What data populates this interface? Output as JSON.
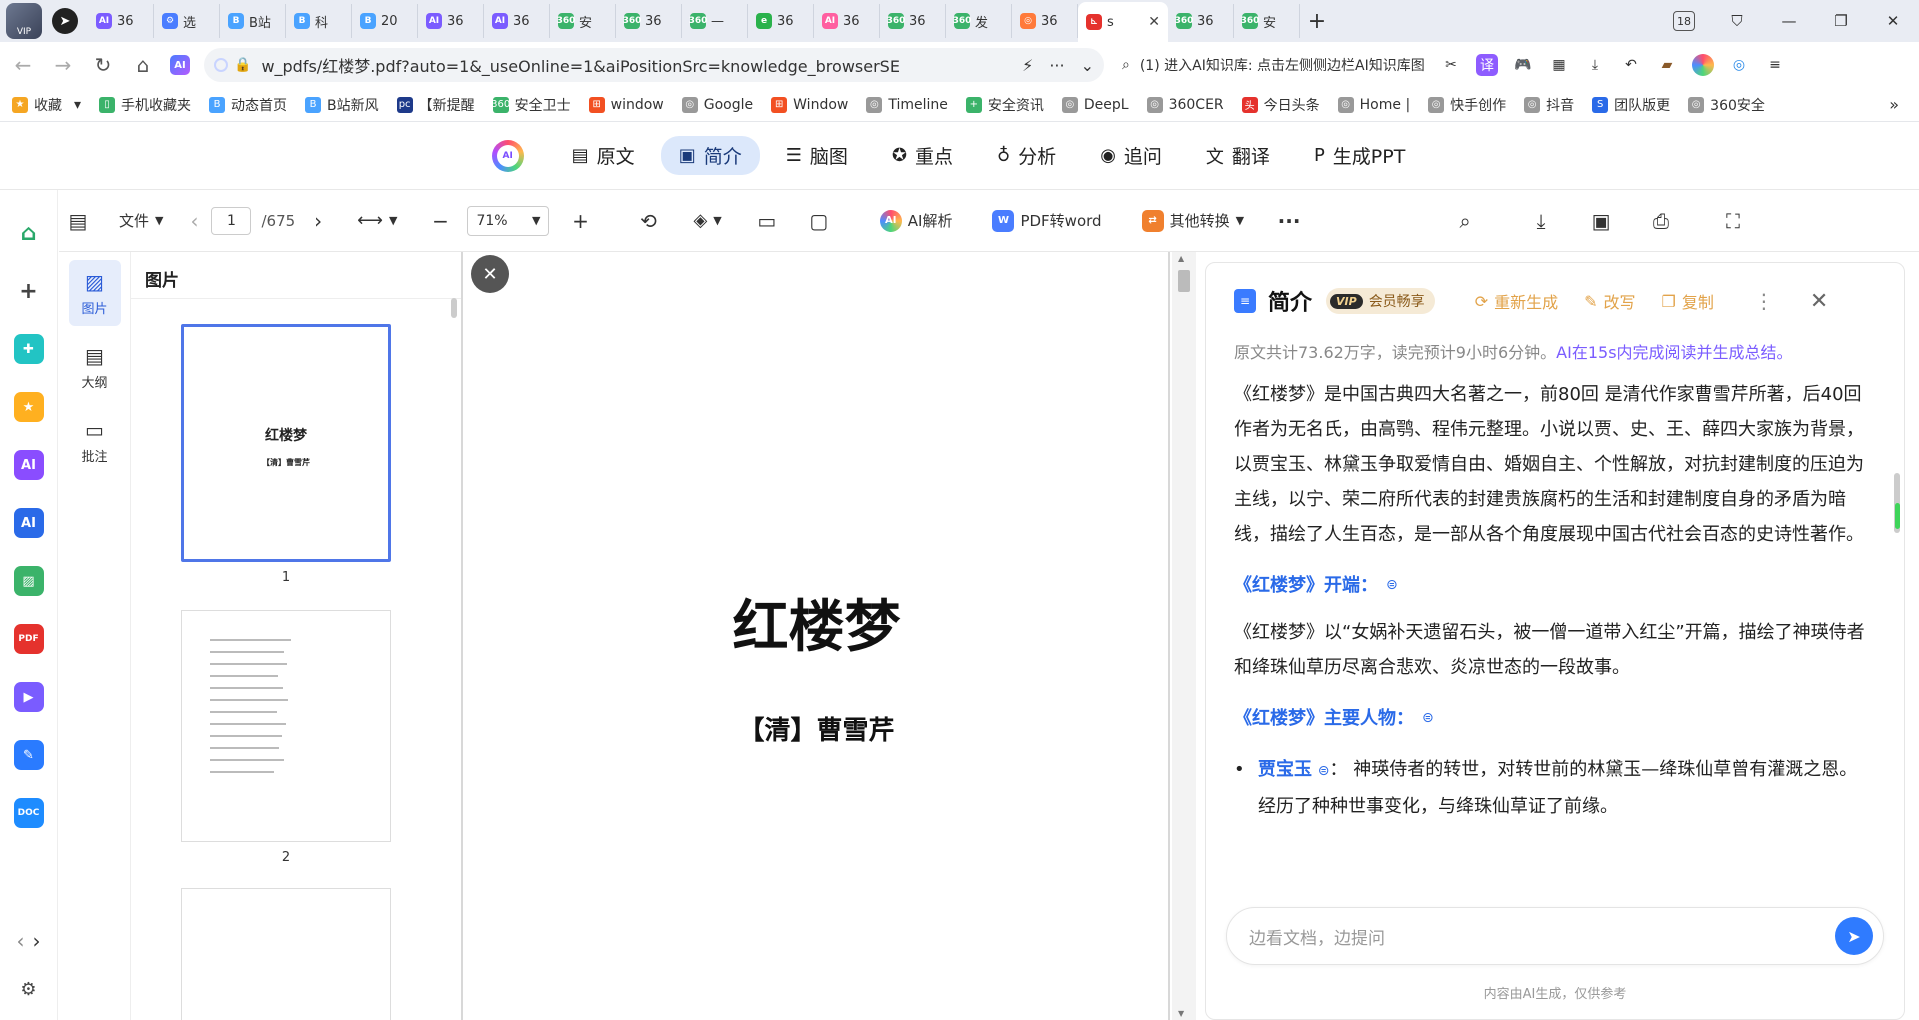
{
  "browser": {
    "tabs": [
      {
        "label": "36",
        "fav": "AI",
        "color": "#7b5cff"
      },
      {
        "label": "选",
        "fav": "⚙",
        "color": "#4a7dff"
      },
      {
        "label": "B站",
        "fav": "B",
        "color": "#4aa3ff"
      },
      {
        "label": "科",
        "fav": "B",
        "color": "#4aa3ff"
      },
      {
        "label": "20",
        "fav": "B",
        "color": "#4aa3ff"
      },
      {
        "label": "36",
        "fav": "AI",
        "color": "#7b5cff"
      },
      {
        "label": "36",
        "fav": "AI",
        "color": "#7b5cff"
      },
      {
        "label": "安",
        "fav": "360",
        "color": "#3bb36a"
      },
      {
        "label": "36",
        "fav": "360",
        "color": "#3bb36a"
      },
      {
        "label": "—",
        "fav": "360",
        "color": "#3bb36a"
      },
      {
        "label": "36",
        "fav": "e",
        "color": "#2bb24c"
      },
      {
        "label": "36",
        "fav": "AI",
        "color": "#ff5fa0"
      },
      {
        "label": "36",
        "fav": "360",
        "color": "#3bb36a"
      },
      {
        "label": "发",
        "fav": "360",
        "color": "#3bb36a"
      },
      {
        "label": "36",
        "fav": "◎",
        "color": "#ff7a3a"
      }
    ],
    "active_tab": {
      "label": "s",
      "fav": "PDF",
      "color": "#e5322d"
    },
    "tabs_after": [
      {
        "label": "36",
        "fav": "360",
        "color": "#3bb36a"
      },
      {
        "label": "安",
        "fav": "360",
        "color": "#3bb36a"
      }
    ],
    "tab_count": "18",
    "url": "w_pdfs/红楼梦.pdf?auto=1&_useOnline=1&aiPositionSrc=knowledge_browserSE",
    "search_text": "(1) 进入AI知识库: 点击左侧侧边栏AI知识库图",
    "bookmarks": [
      {
        "label": "收藏",
        "icon": "★",
        "color": "#f5a623"
      },
      {
        "label": "手机收藏夹",
        "icon": "▯",
        "color": "#3bb36a"
      },
      {
        "label": "动态首页",
        "icon": "B",
        "color": "#4aa3ff"
      },
      {
        "label": "B站新风",
        "icon": "B",
        "color": "#4aa3ff"
      },
      {
        "label": "【新提醒",
        "icon": "pc",
        "color": "#1e3a8a"
      },
      {
        "label": "安全卫士",
        "icon": "360",
        "color": "#3bb36a"
      },
      {
        "label": "window",
        "icon": "⊞",
        "color": "#f25022"
      },
      {
        "label": "Google",
        "icon": "◎",
        "color": "#999"
      },
      {
        "label": "Window",
        "icon": "⊞",
        "color": "#f25022"
      },
      {
        "label": "Timeline",
        "icon": "◎",
        "color": "#999"
      },
      {
        "label": "安全资讯",
        "icon": "+",
        "color": "#3bb36a"
      },
      {
        "label": "DeepL",
        "icon": "◎",
        "color": "#999"
      },
      {
        "label": "360CER",
        "icon": "◎",
        "color": "#999"
      },
      {
        "label": "今日头条",
        "icon": "头",
        "color": "#e5322d"
      },
      {
        "label": "Home |",
        "icon": "◎",
        "color": "#999"
      },
      {
        "label": "快手创作",
        "icon": "◎",
        "color": "#999"
      },
      {
        "label": "抖音",
        "icon": "◎",
        "color": "#999"
      },
      {
        "label": "团队版更",
        "icon": "S",
        "color": "#2a6ae8"
      },
      {
        "label": "360安全",
        "icon": "◎",
        "color": "#999"
      }
    ]
  },
  "features": [
    {
      "label": "原文",
      "icon": "▤"
    },
    {
      "label": "简介",
      "icon": "▣",
      "active": true
    },
    {
      "label": "脑图",
      "icon": "☰"
    },
    {
      "label": "重点",
      "icon": "✪"
    },
    {
      "label": "分析",
      "icon": "♁"
    },
    {
      "label": "追问",
      "icon": "◉"
    },
    {
      "label": "翻译",
      "icon": "文"
    },
    {
      "label": "生成PPT",
      "icon": "P"
    }
  ],
  "toolbar": {
    "file_label": "文件",
    "page_current": "1",
    "page_total": "/675",
    "zoom": "71%",
    "ai_parse": "AI解析",
    "pdf_to_word": "PDF转word",
    "other_convert": "其他转换"
  },
  "side_tabs": [
    {
      "label": "图片",
      "icon": "▨",
      "active": true
    },
    {
      "label": "大纲",
      "icon": "▤"
    },
    {
      "label": "批注",
      "icon": "▭"
    }
  ],
  "thumbs": {
    "title": "图片",
    "page1": {
      "title": "红楼梦",
      "sub": "【清】曹雪芹",
      "num": "1"
    },
    "page2": {
      "num": "2"
    }
  },
  "pdf": {
    "title": "红楼梦",
    "author": "【清】曹雪芹"
  },
  "ai_panel": {
    "title": "简介",
    "vip_badge": "VIP",
    "vip_text": "会员畅享",
    "regenerate": "重新生成",
    "rewrite": "改写",
    "copy": "复制",
    "meta": "原文共计73.62万字，读完预计9小时6分钟。",
    "meta_highlight": "AI在15s内完成阅读并生成总结。",
    "intro": "《红楼梦》是中国古典四大名著之一，前80回 是清代作家曹雪芹所著，后40回 作者为无名氏，由高鹗、程伟元整理。小说以贾、史、王、薛四大家族为背景，以贾宝玉、林黛玉争取爱情自由、婚姻自主、个性解放，对抗封建制度的压迫为主线，以宁、荣二府所代表的封建贵族腐朽的生活和封建制度自身的矛盾为暗线，描绘了人生百态，是一部从各个角度展现中国古代社会百态的史诗性著作。",
    "section1_title": "《红楼梦》开端：",
    "section1_text": "《红楼梦》以“女娲补天遗留石头，被一僧一道带入红尘”开篇，描绘了神瑛侍者和绛珠仙草历尽离合悲欢、炎凉世态的一段故事。",
    "section2_title": "《红楼梦》主要人物：",
    "char1_name": "贾宝玉",
    "char1_text": "：  神瑛侍者的转世，对转世前的林黛玉—绛珠仙草曾有灌溉之恩。经历了种种世事变化，与绛珠仙草证了前缘。",
    "ask_placeholder": "边看文档，边提问",
    "disclaimer": "内容由AI生成，仅供参考"
  }
}
